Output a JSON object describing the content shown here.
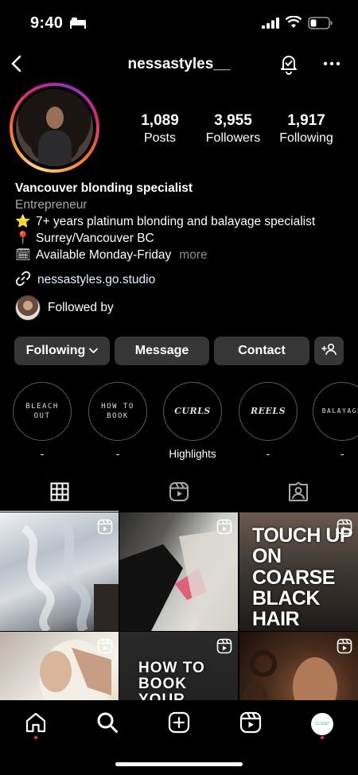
{
  "status_bar": {
    "time": "9:40"
  },
  "header": {
    "username": "nessastyles__"
  },
  "profile": {
    "stats": [
      {
        "value": "1,089",
        "label": "Posts"
      },
      {
        "value": "3,955",
        "label": "Followers"
      },
      {
        "value": "1,917",
        "label": "Following"
      }
    ],
    "bio": {
      "name": "Vancouver blonding specialist",
      "category": "Entrepreneur",
      "lines": [
        {
          "emoji": "⭐",
          "text": "7+ years platinum blonding and balayage specialist"
        },
        {
          "emoji": "📍",
          "text": "Surrey/Vancouver BC"
        },
        {
          "emoji": "🗓",
          "text": "Available Monday-Friday"
        }
      ],
      "more": "more"
    },
    "link": "nessastyles.go.studio",
    "followed_by": "Followed by"
  },
  "actions": {
    "following": "Following",
    "message": "Message",
    "contact": "Contact"
  },
  "highlights": [
    {
      "cover": "BLEACH\nOUT",
      "label": "-"
    },
    {
      "cover": "HOW TO\nBOOK",
      "label": "-"
    },
    {
      "cover": "CURLS",
      "label": "Highlights"
    },
    {
      "cover": "REELS",
      "label": "-"
    },
    {
      "cover": "BALAYAGE",
      "label": "-"
    }
  ],
  "grid_posts": [
    {
      "text": ""
    },
    {
      "text": ""
    },
    {
      "text": "TOUCH UP ON COARSE BLACK HAIR"
    },
    {
      "text": ""
    },
    {
      "text": "HOW TO BOOK YOUR"
    },
    {
      "text": ""
    }
  ],
  "nav_profile_label": "CLOUD"
}
